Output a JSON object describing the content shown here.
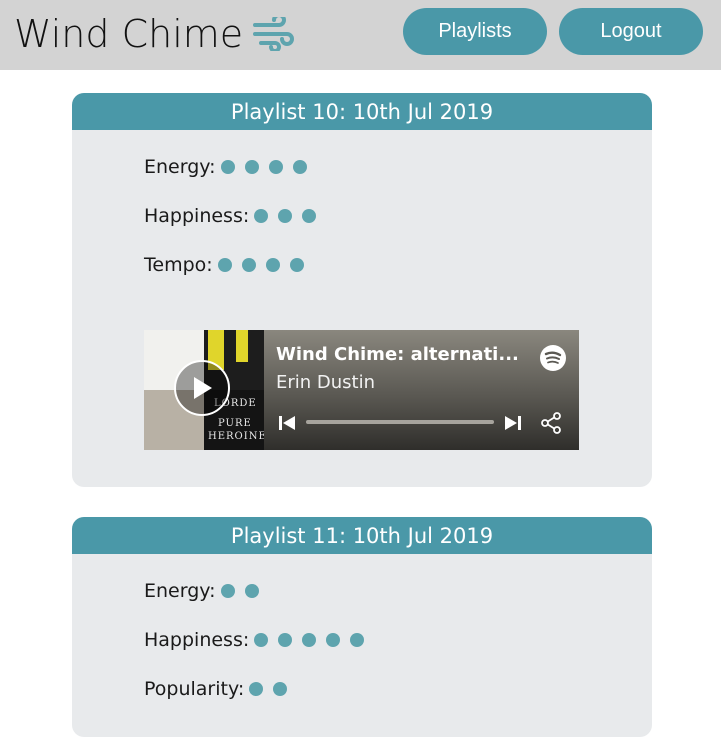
{
  "header": {
    "brand": "Wind Chime",
    "brand_icon": "wind-icon",
    "nav": {
      "playlists": "Playlists",
      "logout": "Logout"
    }
  },
  "colors": {
    "accent": "#4a98a8",
    "dot": "#5ea4ae",
    "card_bg": "#e8eaec",
    "topbar_bg": "#d3d3d3"
  },
  "playlists": [
    {
      "title": "Playlist 10: 10th Jul 2019",
      "metrics": [
        {
          "label": "Energy:",
          "level": 4
        },
        {
          "label": "Happiness:",
          "level": 3
        },
        {
          "label": "Tempo:",
          "level": 4
        }
      ],
      "player": {
        "title": "Wind Chime: alternati...",
        "artist": "Erin Dustin",
        "art_text": [
          "LORDE",
          "PURE",
          "HEROINE"
        ]
      }
    },
    {
      "title": "Playlist 11: 10th Jul 2019",
      "metrics": [
        {
          "label": "Energy:",
          "level": 2
        },
        {
          "label": "Happiness:",
          "level": 5
        },
        {
          "label": "Popularity:",
          "level": 2
        }
      ]
    }
  ]
}
